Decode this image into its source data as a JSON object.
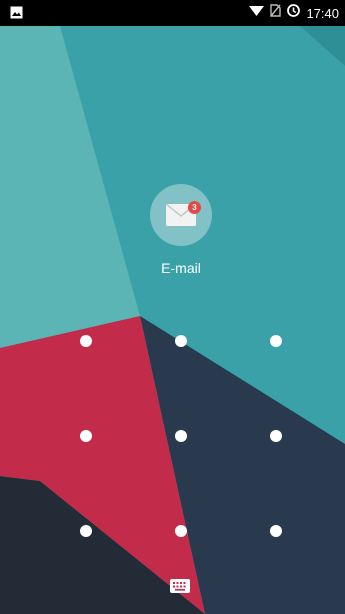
{
  "status_bar": {
    "time": "17:40",
    "icons": [
      "image-notification-icon",
      "wifi-icon",
      "no-sim-icon",
      "data-saver-icon"
    ]
  },
  "notification": {
    "app_label": "E-mail",
    "badge_count": "3",
    "icon": "envelope-icon"
  },
  "pattern_lock": {
    "rows": 3,
    "cols": 3
  },
  "keyboard_toggle": {
    "icon": "keyboard-icon"
  },
  "colors": {
    "teal": "#3aa1a8",
    "light_teal": "#5ab5b4",
    "crimson": "#c32b4b",
    "navy": "#2a3a4e",
    "dark": "#232b36",
    "badge": "#e24a43"
  }
}
